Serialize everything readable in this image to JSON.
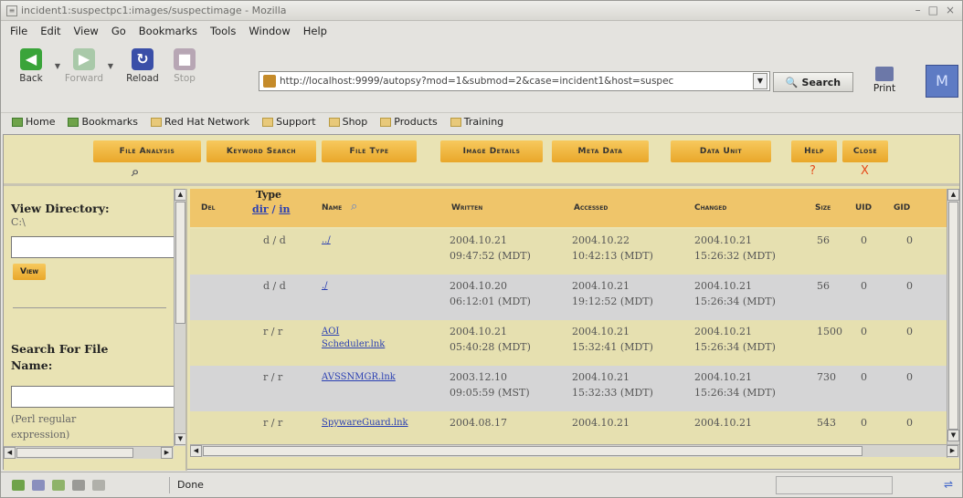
{
  "window": {
    "title": "incident1:suspectpc1:images/suspectimage - Mozilla"
  },
  "menu": [
    "File",
    "Edit",
    "View",
    "Go",
    "Bookmarks",
    "Tools",
    "Window",
    "Help"
  ],
  "nav": {
    "back": "Back",
    "forward": "Forward",
    "reload": "Reload",
    "stop": "Stop",
    "print": "Print",
    "search": "Search"
  },
  "url": "http://localhost:9999/autopsy?mod=1&submod=2&case=incident1&host=suspec",
  "personal_bar": [
    "Home",
    "Bookmarks",
    "Red Hat Network",
    "Support",
    "Shop",
    "Products",
    "Training"
  ],
  "tabs": [
    {
      "label": "File Analysis"
    },
    {
      "label": "Keyword Search"
    },
    {
      "label": "File Type"
    },
    {
      "label": "Image Details"
    },
    {
      "label": "Meta Data"
    },
    {
      "label": "Data Unit"
    },
    {
      "label": "Help",
      "glyph": "?"
    },
    {
      "label": "Close",
      "glyph": "X"
    }
  ],
  "left": {
    "view_dir_title": "View Directory:",
    "view_dir_value": "C:\\",
    "view_button": "View",
    "search_title_1": "Search For File",
    "search_title_2": "Name:",
    "search_hint_1": "(Perl regular",
    "search_hint_2": "expression)"
  },
  "table": {
    "headers": {
      "del": "Del",
      "type_1": "Type",
      "type_dir": "dir",
      "type_slash": " / ",
      "type_in": "in",
      "name": "Name",
      "written": "Written",
      "accessed": "Accessed",
      "changed": "Changed",
      "size": "Size",
      "uid": "UID",
      "gid": "GID"
    },
    "rows": [
      {
        "type": "d / d",
        "name_1": "../",
        "name_2": "",
        "written_1": "2004.10.21",
        "written_2": "09:47:52 (MDT)",
        "accessed_1": "2004.10.22",
        "accessed_2": "10:42:13 (MDT)",
        "changed_1": "2004.10.21",
        "changed_2": "15:26:32 (MDT)",
        "size": "56",
        "uid": "0",
        "gid": "0"
      },
      {
        "type": "d / d",
        "name_1": "./",
        "name_2": "",
        "written_1": "2004.10.20",
        "written_2": "06:12:01 (MDT)",
        "accessed_1": "2004.10.21",
        "accessed_2": "19:12:52 (MDT)",
        "changed_1": "2004.10.21",
        "changed_2": "15:26:34 (MDT)",
        "size": "56",
        "uid": "0",
        "gid": "0"
      },
      {
        "type": "r / r",
        "name_1": "AOI",
        "name_2": "Scheduler.lnk",
        "written_1": "2004.10.21",
        "written_2": "05:40:28 (MDT)",
        "accessed_1": "2004.10.21",
        "accessed_2": "15:32:41 (MDT)",
        "changed_1": "2004.10.21",
        "changed_2": "15:26:34 (MDT)",
        "size": "1500",
        "uid": "0",
        "gid": "0"
      },
      {
        "type": "r / r",
        "name_1": "AVSSNMGR.lnk",
        "name_2": "",
        "written_1": "2003.12.10",
        "written_2": "09:05:59 (MST)",
        "accessed_1": "2004.10.21",
        "accessed_2": "15:32:33 (MDT)",
        "changed_1": "2004.10.21",
        "changed_2": "15:26:34 (MDT)",
        "size": "730",
        "uid": "0",
        "gid": "0"
      },
      {
        "type": "r / r",
        "name_1": "SpywareGuard.lnk",
        "name_2": "",
        "written_1": "2004.08.17",
        "written_2": "",
        "accessed_1": "2004.10.21",
        "accessed_2": "",
        "changed_1": "2004.10.21",
        "changed_2": "",
        "size": "543",
        "uid": "0",
        "gid": "0"
      }
    ]
  },
  "status": {
    "text": "Done"
  },
  "colors": {
    "tab": "#e9a72a",
    "frame_bg": "#e9e3b4",
    "header_bg": "#efc56a",
    "row_alt": "#d5d5d6",
    "link": "#2a3fb2"
  }
}
